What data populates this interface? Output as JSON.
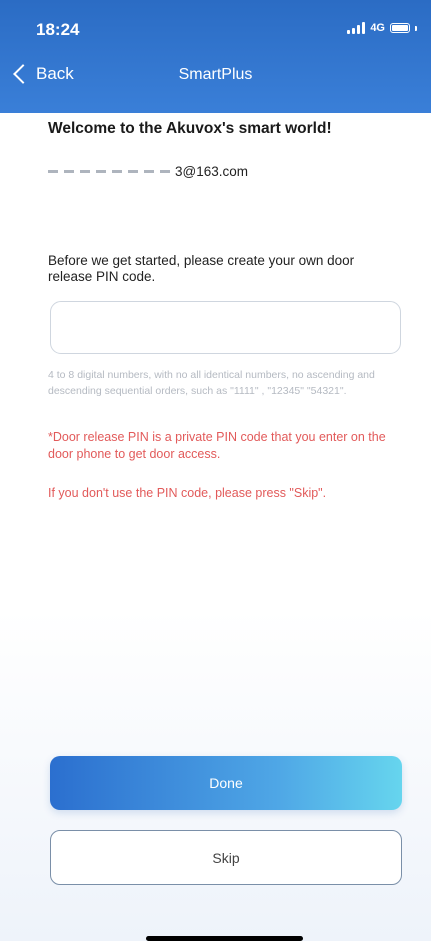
{
  "status_bar": {
    "time": "18:24",
    "network": "4G",
    "icons": [
      "signal-icon",
      "battery-icon"
    ]
  },
  "nav": {
    "back_label": "Back",
    "title": "SmartPlus"
  },
  "welcome": "Welcome to the Akuvox's smart world!",
  "email_visible": "3@163.com",
  "instruction": "Before we get started, please create your own door release PIN code.",
  "pin_input": {
    "value": "",
    "placeholder": ""
  },
  "hint": "4 to 8 digital numbers, with no all identical numbers, no ascending and descending sequential orders, such as \"1111\" , \"12345\" \"54321\".",
  "note": "*Door release PIN is a private PIN code that you enter on the door phone to get door access.",
  "skip_note": "If you don't use the PIN code, please press \"Skip\".",
  "buttons": {
    "done": "Done",
    "skip": "Skip"
  },
  "colors": {
    "header": "#2b6cc4",
    "accent_start": "#2b6fcf",
    "accent_end": "#66d5ee",
    "warning_text": "#e25a5a"
  }
}
